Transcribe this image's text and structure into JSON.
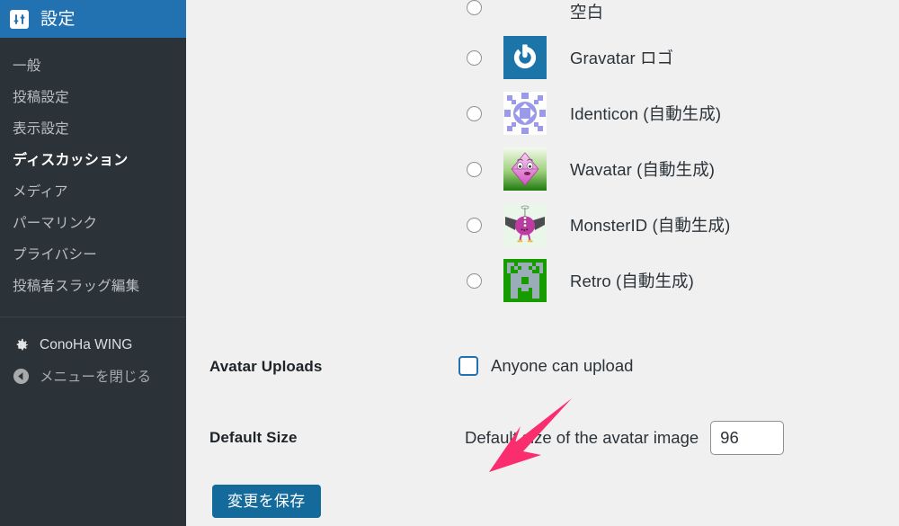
{
  "sidebar": {
    "header": {
      "icon": "settings-sliders-icon",
      "title": "設定"
    },
    "items": [
      {
        "label": "一般",
        "current": false
      },
      {
        "label": "投稿設定",
        "current": false
      },
      {
        "label": "表示設定",
        "current": false
      },
      {
        "label": "ディスカッション",
        "current": true
      },
      {
        "label": "メディア",
        "current": false
      },
      {
        "label": "パーマリンク",
        "current": false
      },
      {
        "label": "プライバシー",
        "current": false
      },
      {
        "label": "投稿者スラッグ編集",
        "current": false
      }
    ],
    "bottom": [
      {
        "label": "ConoHa WING",
        "icon": "gear-icon",
        "muted": false
      },
      {
        "label": "メニューを閉じる",
        "icon": "collapse-left-icon",
        "muted": true
      }
    ]
  },
  "main": {
    "avatar_options": [
      {
        "label": "空白",
        "thumb": "none",
        "selected": false
      },
      {
        "label": "Gravatar ロゴ",
        "thumb": "gravatar",
        "selected": false
      },
      {
        "label": "Identicon (自動生成)",
        "thumb": "identicon",
        "selected": false
      },
      {
        "label": "Wavatar (自動生成)",
        "thumb": "wavatar",
        "selected": false
      },
      {
        "label": "MonsterID (自動生成)",
        "thumb": "monster",
        "selected": false
      },
      {
        "label": "Retro (自動生成)",
        "thumb": "retro",
        "selected": false
      }
    ],
    "avatar_uploads": {
      "label": "Avatar Uploads",
      "checkbox_label": "Anyone can upload",
      "checked": false
    },
    "default_size": {
      "label": "Default Size",
      "description": "Default size of the avatar image",
      "value": "96"
    },
    "save_label": "変更を保存"
  },
  "annotation": {
    "type": "arrow",
    "color": "#fa2d6e",
    "points_to": "default-size-row"
  },
  "colors": {
    "admin_blue": "#2271b1",
    "sidebar_dark": "#2c3338",
    "page_bg": "#f0f0f1",
    "button_blue": "#146a9b",
    "arrow_pink": "#fa2d6e"
  }
}
